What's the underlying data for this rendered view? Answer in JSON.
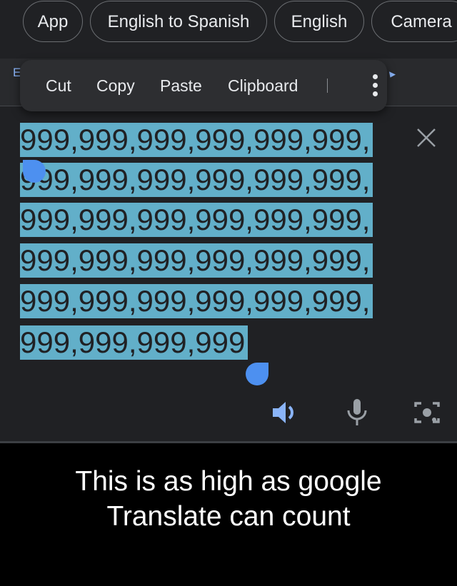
{
  "top_chips": [
    {
      "label": "App"
    },
    {
      "label": "English to Spanish"
    },
    {
      "label": "English"
    },
    {
      "label": "Camera"
    }
  ],
  "lang_bar": {
    "leading_letter": "E"
  },
  "context_menu": {
    "items": [
      {
        "label": "Cut"
      },
      {
        "label": "Copy"
      },
      {
        "label": "Paste"
      },
      {
        "label": "Clipboard"
      }
    ]
  },
  "source_text": {
    "lines": [
      "999,999,999,999,999,999,",
      "999,999,999,999,999,999,",
      "999,999,999,999,999,999,",
      "999,999,999,999,999,999,",
      "999,999,999,999,999,999,",
      "999,999,999,999"
    ]
  },
  "icons": {
    "close": "close-icon",
    "speaker": "speaker-icon",
    "mic": "microphone-icon",
    "camera": "camera-icon",
    "more": "more-vertical-icon"
  },
  "colors": {
    "selection": "#62afc9",
    "handle": "#4d90f0",
    "accent": "#8ab4f8"
  },
  "caption": {
    "line1": "This is as high as google",
    "line2": "Translate can count"
  }
}
